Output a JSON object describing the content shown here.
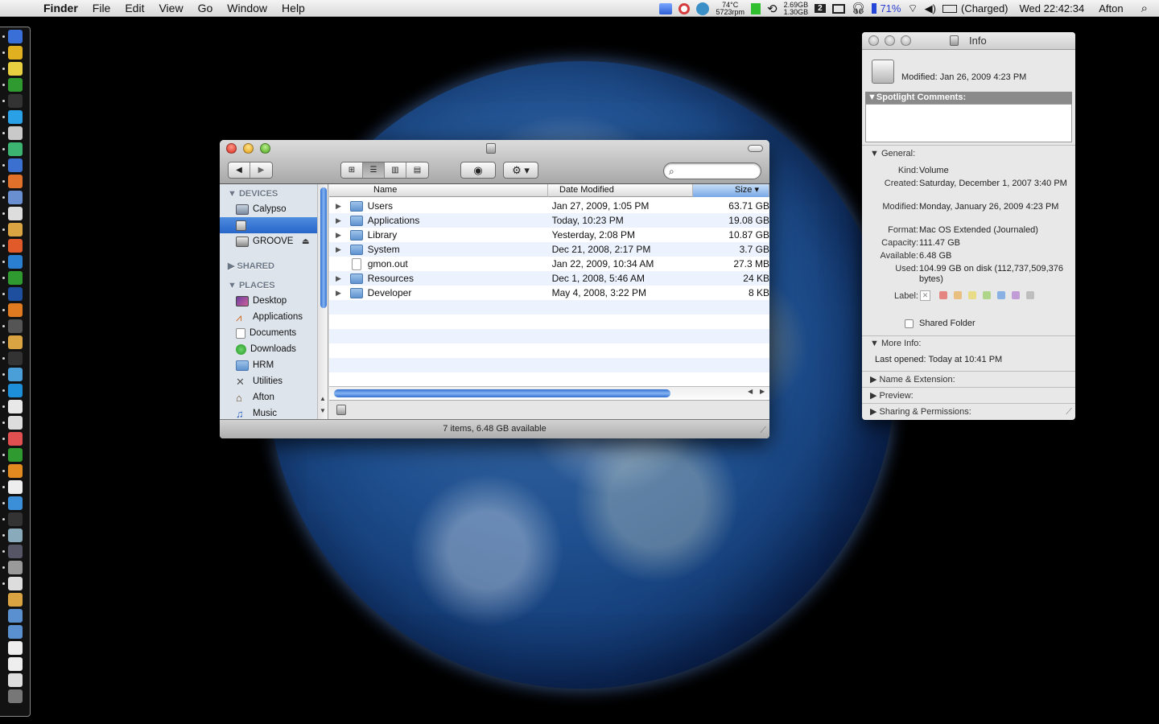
{
  "menubar": {
    "app_name": "Finder",
    "menus": [
      "File",
      "Edit",
      "View",
      "Go",
      "Window",
      "Help"
    ],
    "status": {
      "temp": "74°C",
      "rpm": "5723rpm",
      "mem_top": "2.69GB",
      "mem_bottom": "1.30GB",
      "badge_number": "2",
      "battery_percent": "71%",
      "charge_status": "(Charged)",
      "clock": "Wed 22:42:34",
      "user": "Afton"
    }
  },
  "finder": {
    "sidebar": {
      "devices_header": "DEVICES",
      "devices": [
        "Calypso",
        "",
        "GROOVE"
      ],
      "shared_header": "SHARED",
      "places_header": "PLACES",
      "places": [
        "Desktop",
        "Applications",
        "Documents",
        "Downloads",
        "HRM",
        "Utilities",
        "Afton",
        "Music"
      ]
    },
    "columns": {
      "name": "Name",
      "date": "Date Modified",
      "size": "Size"
    },
    "rows": [
      {
        "name": "Users",
        "date": "Jan 27, 2009, 1:05 PM",
        "size": "63.71 GB"
      },
      {
        "name": "Applications",
        "date": "Today, 10:23 PM",
        "size": "19.08 GB"
      },
      {
        "name": "Library",
        "date": "Yesterday, 2:08 PM",
        "size": "10.87 GB"
      },
      {
        "name": "System",
        "date": "Dec 21, 2008, 2:17 PM",
        "size": "3.7 GB"
      },
      {
        "name": "gmon.out",
        "date": "Jan 22, 2009, 10:34 AM",
        "size": "27.3 MB"
      },
      {
        "name": "Resources",
        "date": "Dec 1, 2008, 5:46 AM",
        "size": "24 KB"
      },
      {
        "name": "Developer",
        "date": "May 4, 2008, 3:22 PM",
        "size": "8 KB"
      }
    ],
    "status_text": "7 items, 6.48 GB available"
  },
  "info": {
    "title": "Info",
    "modified_header": "Modified: Jan 26, 2009 4:23 PM",
    "spotlight_header": "Spotlight Comments:",
    "general_header": "General:",
    "kind_label": "Kind:",
    "kind_value": "Volume",
    "created_label": "Created:",
    "created_value": "Saturday, December 1, 2007 3:40 PM",
    "modified_label": "Modified:",
    "modified_value": "Monday, January 26, 2009 4:23 PM",
    "format_label": "Format:",
    "format_value": "Mac OS Extended (Journaled)",
    "capacity_label": "Capacity:",
    "capacity_value": "111.47 GB",
    "available_label": "Available:",
    "available_value": "6.48 GB",
    "used_label": "Used:",
    "used_value": "104.99 GB on disk (112,737,509,376 bytes)",
    "label_label": "Label:",
    "label_colors": [
      "#e0332c",
      "#e89a2c",
      "#e8d23a",
      "#7fc43c",
      "#3d84e0",
      "#a05cc9",
      "#9a9a9a"
    ],
    "shared_folder_label": "Shared Folder",
    "more_info_header": "More Info:",
    "last_opened": "Last opened: Today at 10:41 PM",
    "name_ext_header": "Name & Extension:",
    "preview_header": "Preview:",
    "sharing_header": "Sharing & Permissions:"
  }
}
